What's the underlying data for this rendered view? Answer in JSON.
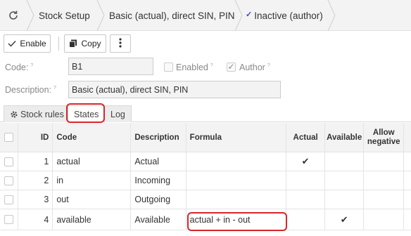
{
  "breadcrumb": {
    "items": [
      {
        "label": "Stock Setup"
      },
      {
        "label": "Basic (actual), direct SIN, PIN"
      },
      {
        "label": "Inactive (author)"
      }
    ]
  },
  "toolbar": {
    "enable_label": "Enable",
    "copy_label": "Copy"
  },
  "form": {
    "code_label": "Code:",
    "code_value": "B1",
    "enabled_label": "Enabled",
    "enabled_checked": false,
    "author_label": "Author",
    "author_checked": true,
    "description_label": "Description:",
    "description_value": "Basic (actual), direct SIN, PIN",
    "help_marker": "?"
  },
  "tabs": [
    {
      "label": "Stock rules",
      "icon": "gear-icon"
    },
    {
      "label": "States",
      "active": true
    },
    {
      "label": "Log"
    }
  ],
  "table": {
    "columns": [
      "ID",
      "Code",
      "Description",
      "Formula",
      "Actual",
      "Available",
      "Allow negative"
    ],
    "rows": [
      {
        "id": "1",
        "code": "actual",
        "description": "Actual",
        "formula": "",
        "actual": true,
        "available": false
      },
      {
        "id": "2",
        "code": "in",
        "description": "Incoming",
        "formula": "",
        "actual": false,
        "available": false
      },
      {
        "id": "3",
        "code": "out",
        "description": "Outgoing",
        "formula": "",
        "actual": false,
        "available": false
      },
      {
        "id": "4",
        "code": "available",
        "description": "Available",
        "formula": "actual + in - out",
        "actual": false,
        "available": true
      }
    ]
  },
  "colors": {
    "highlight": "#d7262a",
    "accent": "#3a49c4"
  }
}
